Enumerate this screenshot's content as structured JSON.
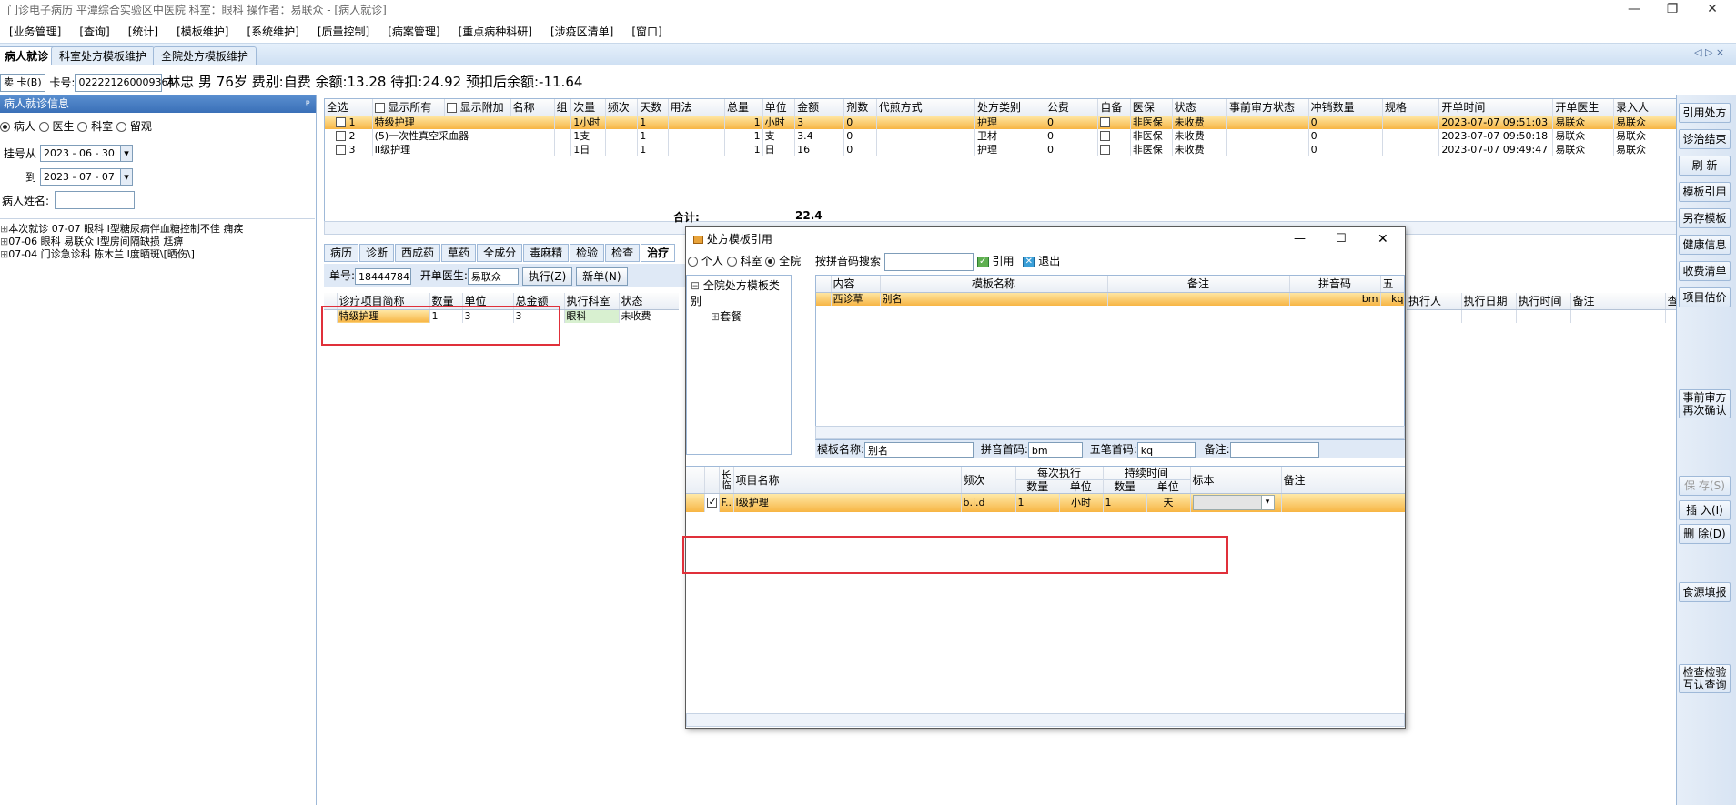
{
  "window": {
    "title": "门诊电子病历 平潭综合实验区中医院 科室：眼科 操作者：易联众 - [病人就诊]",
    "controls": [
      "—",
      "❐",
      "✕"
    ]
  },
  "menu": [
    "[业务管理]",
    "[查询]",
    "[统计]",
    "[模板维护]",
    "[系统维护]",
    "[质量控制]",
    "[病案管理]",
    "[重点病种科研]",
    "[涉疫区清单]",
    "[窗口]"
  ],
  "tabs": [
    "病人就诊",
    "科室处方模板维护",
    "全院处方模板维护"
  ],
  "tab_nav": "◁ ▷ ×",
  "patient": {
    "card_label": "卖 卡(B)",
    "card_no_label": "卡号:",
    "card_no": "022221260009364",
    "info": "林忠 男 76岁 费别:自费 余额:13.28 待扣:24.92 预扣后余额:-11.64"
  },
  "left": {
    "header": "病人就诊信息",
    "pin": "ᵖ",
    "radios": [
      "病人",
      "医生",
      "科室",
      "留观"
    ],
    "reg_from_label": "挂号从",
    "reg_from": "2023 - 06 - 30",
    "reg_to_label": "到",
    "reg_to": "2023 - 07 - 07",
    "name_label": "病人姓名:",
    "tree": [
      "本次就诊 07-07 眼科 I型糖尿病伴血糖控制不佳 痈疾",
      "07-06 眼科 易联众 I型房间隔缺损 尪痹",
      "07-04 门诊急诊科 陈木兰 I度晒斑\\[晒伤\\]"
    ]
  },
  "rx": {
    "headers": [
      "全选",
      "显示所有",
      "显示附加",
      "名称",
      "组",
      "次量",
      "频次",
      "天数",
      "用法",
      "总量",
      "单位",
      "金额",
      "剂数",
      "代煎方式",
      "处方类别",
      "公费",
      "自备",
      "医保",
      "状态",
      "事前审方状态",
      "冲销数量",
      "规格",
      "开单时间",
      "开单医生",
      "录入人"
    ],
    "rows": [
      [
        "1",
        "特级护理",
        "1小时",
        "1",
        "1",
        "小时",
        "3",
        "0",
        "护理",
        "0",
        "非医保",
        "未收费",
        "0",
        "2023-07-07 09:51:03",
        "易联众",
        "易联众"
      ],
      [
        "2",
        "(5)一次性真空采血器",
        "1支",
        "1",
        "1",
        "支",
        "3.4",
        "0",
        "卫材",
        "0",
        "非医保",
        "未收费",
        "0",
        "2023-07-07 09:50:18",
        "易联众",
        "易联众"
      ],
      [
        "3",
        "II级护理",
        "1日",
        "1",
        "1",
        "日",
        "16",
        "0",
        "护理",
        "0",
        "非医保",
        "未收费",
        "0",
        "2023-07-07 09:49:47",
        "易联众",
        "易联众"
      ]
    ],
    "total_label": "合计:",
    "total": "22.4"
  },
  "bottom": {
    "tabs": [
      "病历",
      "诊断",
      "西成药",
      "草药",
      "全成分",
      "毒麻精",
      "检验",
      "检查",
      "治疗"
    ],
    "order_label": "单号:",
    "order_no": "18444784",
    "doctor_label": "开单医生:",
    "doctor": "易联众",
    "exec_btn": "执行(Z)",
    "new_btn": "新单(N)",
    "headers": [
      "诊疗项目简称",
      "数量",
      "单位",
      "总金额",
      "执行科室",
      "状态"
    ],
    "row": [
      "特级护理",
      "1",
      "3",
      "3",
      "眼科",
      "未收费"
    ],
    "right_headers": [
      "执行人",
      "执行日期",
      "执行时间",
      "备注",
      "查"
    ]
  },
  "right_buttons": [
    "引用处方",
    "诊治结束",
    "刷 新",
    "模板引用",
    "另存模板",
    "健康信息",
    "收费清单",
    "项目估价",
    "事前审方再次确认",
    "保 存(S)",
    "插 入(I)",
    "删 除(D)",
    "食源填报",
    "检查检验互认查询"
  ],
  "dialog": {
    "title": "处方模板引用",
    "controls": [
      "—",
      "☐",
      "✕"
    ],
    "scope": [
      "个人",
      "科室",
      "全院"
    ],
    "search_label": "按拼音码搜索",
    "ref_btn": "引用",
    "exit_btn": "退出",
    "tree_root": "全院处方模板类别",
    "tree_child": "套餐",
    "tmpl_headers": [
      "内容",
      "模板名称",
      "备注",
      "拼音码",
      "五"
    ],
    "tmpl_row": [
      "西诊草",
      "别名",
      "",
      "bm",
      "kq"
    ],
    "name_label": "模板名称:",
    "name_value": "别名",
    "py_label": "拼音首码:",
    "py_value": "bm",
    "wb_label": "五笔首码:",
    "wb_value": "kq",
    "remark_label": "备注:",
    "detail_headers": [
      "长临",
      "项目名称",
      "频次",
      "每次执行",
      "持续时间",
      "标本",
      "备注"
    ],
    "detail_sub": [
      "数量",
      "单位",
      "数量",
      "单位"
    ],
    "detail_row": [
      "F..",
      "I级护理",
      "b.i.d",
      "1",
      "小时",
      "1",
      "天"
    ]
  }
}
